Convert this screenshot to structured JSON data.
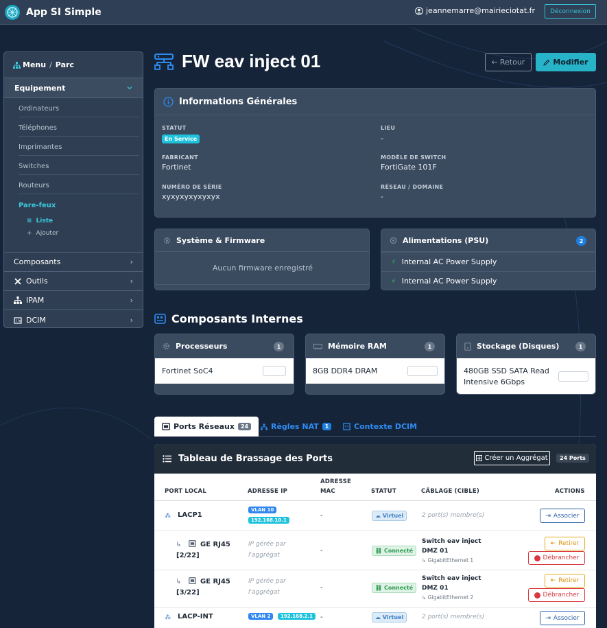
{
  "app": {
    "title": "App SI Simple",
    "user_email": "jeannemarre@mairieciotat.fr",
    "logout_label": "Déconnexion"
  },
  "sidebar": {
    "breadcrumb_root": "Menu",
    "breadcrumb_sep": "/",
    "breadcrumb_current": "Parc",
    "section": "Equipement",
    "links": [
      "Ordinateurs",
      "Téléphones",
      "Imprimantes",
      "Switches",
      "Routeurs",
      "Pare-feux"
    ],
    "sublinks": [
      "Liste",
      "Ajouter"
    ],
    "items": [
      "Composants",
      "Outils",
      "IPAM",
      "DCIM"
    ]
  },
  "page": {
    "title": "FW eav inject 01",
    "back_label": "Retour",
    "edit_label": "Modifier"
  },
  "general": {
    "title": "Informations Générales",
    "fields": [
      {
        "label": "STATUT",
        "value": "En Service"
      },
      {
        "label": "LIEU",
        "value": "-"
      },
      {
        "label": "FABRICANT",
        "value": "Fortinet"
      },
      {
        "label": "MODÈLE DE SWITCH",
        "value": "FortiGate 101F"
      },
      {
        "label": "NUMÉRO DE SÉRIE",
        "value": "xyxyxyxyxyxyx"
      },
      {
        "label": "RÉSEAU / DOMAINE",
        "value": "-"
      }
    ]
  },
  "firmware": {
    "title": "Système & Firmware",
    "empty": "Aucun firmware enregistré"
  },
  "psu": {
    "title": "Alimentations (PSU)",
    "count": "2",
    "items": [
      "Internal AC Power Supply",
      "Internal AC Power Supply"
    ]
  },
  "components": {
    "title": "Composants Internes",
    "cards": [
      {
        "title": "Processeurs",
        "count": "1",
        "value": "Fortinet SoC4"
      },
      {
        "title": "Mémoire RAM",
        "count": "1",
        "value": "8GB DDR4 DRAM"
      },
      {
        "title": "Stockage (Disques)",
        "count": "1",
        "value_line1": "480GB SSD SATA Read",
        "value_line2": "Intensive 6Gbps"
      }
    ]
  },
  "tabs": [
    {
      "label": "Ports Réseaux",
      "count": "24"
    },
    {
      "label": "Règles NAT",
      "count": "1"
    },
    {
      "label": "Contexte DCIM"
    }
  ],
  "ports": {
    "title": "Tableau de Brassage des Ports",
    "create_agg_label": "Créer un Aggrégat",
    "ports_badge": "24 Ports",
    "columns": {
      "port": "PORT LOCAL",
      "ip": "ADRESSE IP",
      "mac1": "ADRESSE",
      "mac2": "MAC",
      "status": "STATUT",
      "cabling": "CÂBLAGE (CIBLE)",
      "actions": "ACTIONS"
    },
    "rows": [
      {
        "port": "LACP1",
        "vlan": "VLAN 10",
        "ip": "192.168.10.1",
        "mac": "-",
        "status": "Virtuel",
        "cabling": "2 port(s) membre(s)",
        "action": "Associer"
      },
      {
        "port_l1": "GE RJ45",
        "port_l2": "[2/22]",
        "ip_l1": "IP gérée par",
        "ip_l2": "l'aggrégat",
        "mac": "-",
        "status": "Connecté",
        "target_l1": "Switch eav inject",
        "target_l2": "DMZ 01",
        "target_if": "GigabitEthernet 1",
        "action1": "Retirer",
        "action2": "Débrancher"
      },
      {
        "port_l1": "GE RJ45",
        "port_l2": "[3/22]",
        "ip_l1": "IP gérée par",
        "ip_l2": "l'aggrégat",
        "mac": "-",
        "status": "Connecté",
        "target_l1": "Switch eav inject",
        "target_l2": "DMZ 01",
        "target_if": "GigabitEthernet 2",
        "action1": "Retirer",
        "action2": "Débrancher"
      },
      {
        "port": "LACP-INT",
        "vlan": "VLAN 2",
        "ip": "192.168.2.1",
        "mac": "-",
        "status": "Virtuel",
        "cabling": "2 port(s) membre(s)",
        "action": "Associer"
      }
    ]
  },
  "colors": {
    "accent": "#27b3c8",
    "bg": "#16243a",
    "card": "#3a4a5f",
    "link": "#2e8cf0"
  }
}
